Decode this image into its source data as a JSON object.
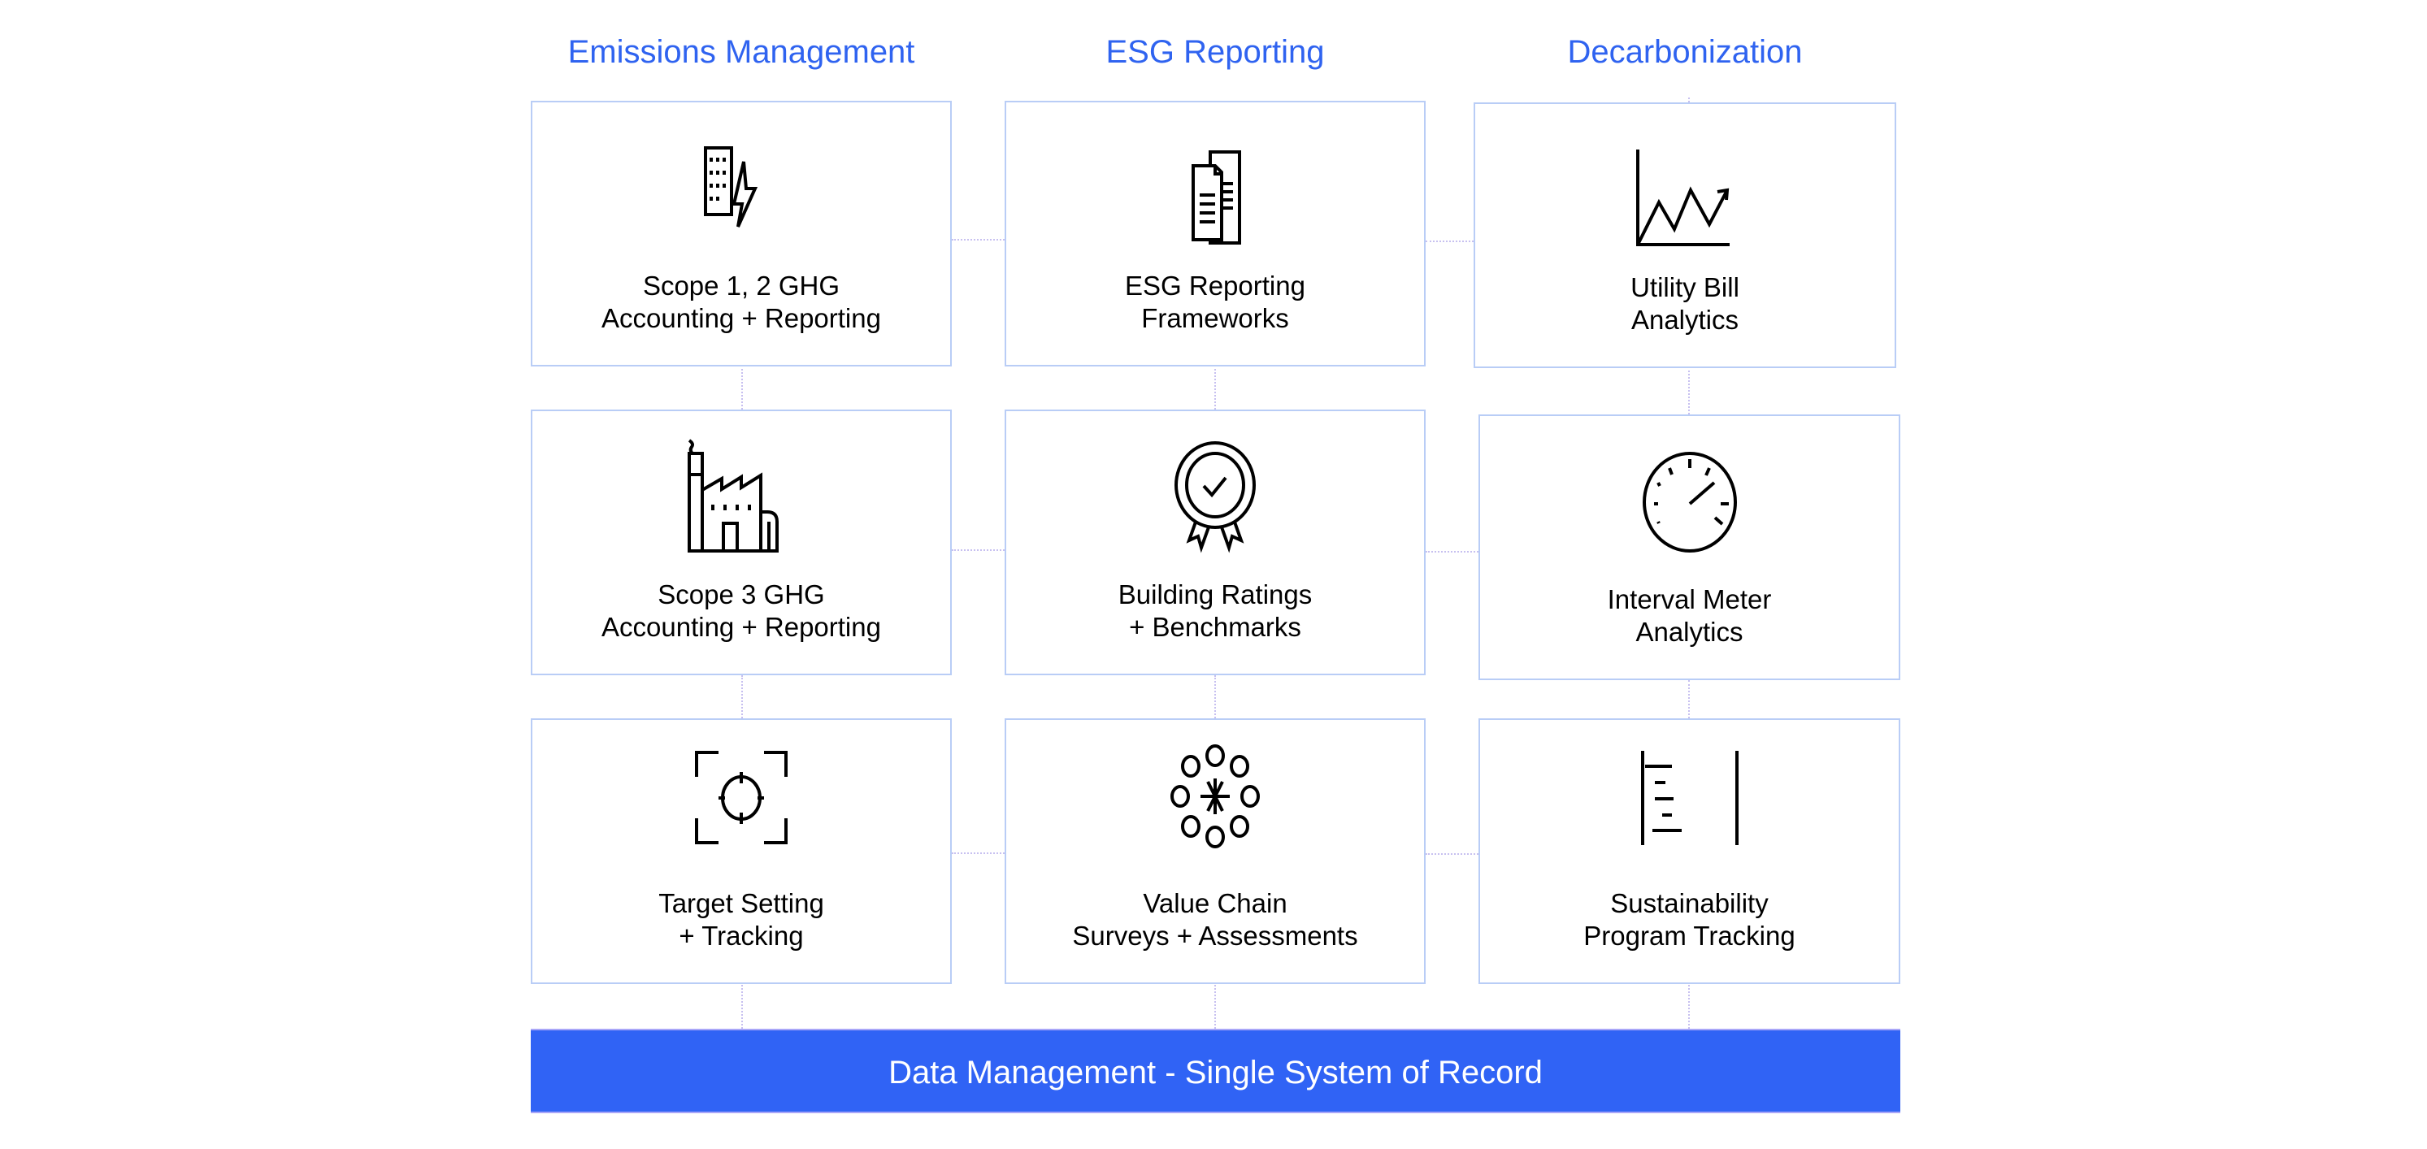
{
  "columns": [
    {
      "title": "Emissions Management"
    },
    {
      "title": "ESG Reporting"
    },
    {
      "title": "Decarbonization"
    }
  ],
  "cards": [
    {
      "icon": "building-lightning-icon",
      "line1": "Scope 1, 2 GHG",
      "line2": "Accounting + Reporting"
    },
    {
      "icon": "documents-icon",
      "line1": "ESG Reporting",
      "line2": "Frameworks"
    },
    {
      "icon": "line-chart-up-icon",
      "line1": "Utility Bill",
      "line2": "Analytics"
    },
    {
      "icon": "factory-icon",
      "line1": "Scope 3 GHG",
      "line2": "Accounting + Reporting"
    },
    {
      "icon": "award-ribbon-icon",
      "line1": "Building Ratings",
      "line2": "+ Benchmarks"
    },
    {
      "icon": "gauge-meter-icon",
      "line1": "Interval Meter",
      "line2": "Analytics"
    },
    {
      "icon": "target-crosshair-icon",
      "line1": "Target Setting",
      "line2": "+ Tracking"
    },
    {
      "icon": "network-circles-icon",
      "line1": "Value Chain",
      "line2": "Surveys + Assessments"
    },
    {
      "icon": "list-bracket-icon",
      "line1": "Sustainability",
      "line2": "Program Tracking"
    }
  ],
  "footer_bar": {
    "label": "Data Management - Single System of Record"
  },
  "colors": {
    "accent": "#2f63f0",
    "bar": "#3063f5",
    "border": "#b9cdf6"
  }
}
